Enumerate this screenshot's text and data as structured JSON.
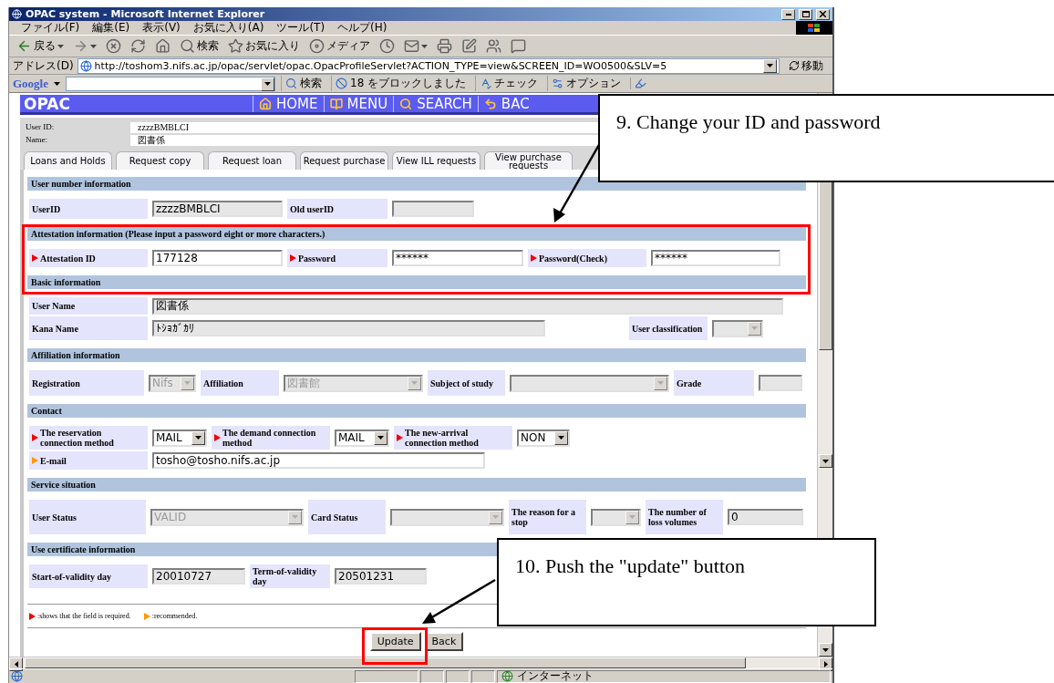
{
  "window": {
    "title": "OPAC system - Microsoft Internet Explorer"
  },
  "menu": [
    "ファイル(F)",
    "編集(E)",
    "表示(V)",
    "お気に入り(A)",
    "ツール(T)",
    "ヘルプ(H)"
  ],
  "toolbar": [
    {
      "kind": "back",
      "label": "戻る"
    },
    {
      "kind": "forward"
    },
    {
      "kind": "stop"
    },
    {
      "kind": "refresh"
    },
    {
      "kind": "home"
    },
    {
      "kind": "search",
      "label": "検索"
    },
    {
      "kind": "favorites",
      "label": "お気に入り"
    },
    {
      "kind": "media",
      "label": "メディア"
    },
    {
      "kind": "history"
    },
    {
      "kind": "mail"
    },
    {
      "kind": "print"
    },
    {
      "kind": "edit"
    },
    {
      "kind": "discuss"
    },
    {
      "kind": "messenger"
    }
  ],
  "address": {
    "label": "アドレス(D)",
    "url": "http://toshom3.nifs.ac.jp/opac/servlet/opac.OpacProfileServlet?ACTION_TYPE=view&SCREEN_ID=WO0500&SLV=5",
    "go": "移動"
  },
  "google_bar": {
    "logo": "Google",
    "items": [
      {
        "kind": "search",
        "label": "検索"
      },
      {
        "kind": "blocked",
        "label": "18 をブロックしました"
      },
      {
        "kind": "check",
        "label": "チェック"
      },
      {
        "kind": "options",
        "label": "オプション"
      },
      {
        "kind": "highlight"
      }
    ]
  },
  "opac": {
    "logo": "OPAC",
    "nav": [
      {
        "kind": "home",
        "label": "HOME"
      },
      {
        "kind": "menu",
        "label": "MENU"
      },
      {
        "kind": "search",
        "label": "SEARCH"
      },
      {
        "kind": "back",
        "label": "BAC"
      }
    ]
  },
  "user": {
    "id_label": "User ID:",
    "id": "zzzzBMBLCI",
    "name_label": "Name:",
    "name": "図書係"
  },
  "tabs": [
    "Loans and Holds",
    "Request copy",
    "Request loan",
    "Request purchase",
    "View ILL requests",
    "View purchase requests"
  ],
  "sections": [
    {
      "title": "User number information",
      "rows": [
        [
          {
            "label": "UserID",
            "kind": "text",
            "value": "zzzzBMBLCI",
            "disabled": true
          },
          {
            "label": "Old userID",
            "kind": "text",
            "disabled": true
          }
        ]
      ]
    },
    {
      "title": "Attestation information (Please input a password eight or more characters.)",
      "rows": [
        [
          {
            "label": "Attestation ID",
            "color": "#f00000",
            "kind": "text",
            "value": "177128",
            "disabled": false
          },
          {
            "label": "Password",
            "color": "#f00000",
            "kind": "text",
            "value": "******",
            "disabled": false
          },
          {
            "label": "Password(Check)",
            "color": "#f00000",
            "kind": "text",
            "value": "******",
            "disabled": false
          }
        ]
      ]
    },
    {
      "title": "Basic information",
      "rows": [
        [
          {
            "label": "User Name",
            "kind": "text",
            "value": "図書係",
            "disabled": true
          }
        ],
        [
          {
            "label": "Kana Name",
            "kind": "text",
            "value": "ﾄｼｮｶﾞｶﾘ",
            "disabled": true
          },
          {
            "label": "User classification",
            "kind": "select",
            "disabled": true
          }
        ]
      ]
    },
    {
      "title": "Affiliation information",
      "rows": [
        [
          {
            "label": "Registration",
            "kind": "select",
            "value": "Nifs",
            "disabled": true
          },
          {
            "label": "Affiliation",
            "kind": "select",
            "value": "図書館",
            "disabled": true
          },
          {
            "label": "Subject of study",
            "kind": "select",
            "disabled": true
          },
          {
            "label": "Grade",
            "kind": "text",
            "disabled": true
          }
        ]
      ]
    },
    {
      "title": "Contact",
      "rows": [
        [
          {
            "label": "The reservation connection method",
            "color": "#f00000",
            "kind": "select",
            "value": "MAIL",
            "disabled": false
          },
          {
            "label": "The demand connection method",
            "color": "#f00000",
            "kind": "select",
            "value": "MAIL",
            "disabled": false
          },
          {
            "label": "The new-arrival connection method",
            "color": "#f00000",
            "kind": "select",
            "value": "NON",
            "disabled": false
          }
        ],
        [
          {
            "label": "E-mail",
            "color": "#ff9900",
            "kind": "text",
            "value": "tosho@tosho.nifs.ac.jp",
            "disabled": false
          }
        ]
      ]
    },
    {
      "title": "Service situation",
      "rows": [
        [
          {
            "label": "User Status",
            "kind": "select",
            "value": "VALID",
            "disabled": true
          },
          {
            "label": "Card Status",
            "kind": "select",
            "disabled": true
          },
          {
            "label": "The reason for a stop",
            "kind": "select",
            "disabled": true
          },
          {
            "label": "The number of loss volumes",
            "kind": "text",
            "value": "0",
            "disabled": true
          }
        ]
      ]
    },
    {
      "title": "Use certificate information",
      "rows": [
        [
          {
            "label": "Start-of-validity day",
            "kind": "text",
            "value": "20010727",
            "disabled": true
          },
          {
            "label": "Term-of-validity day",
            "kind": "text",
            "value": "20501231",
            "disabled": true
          }
        ]
      ]
    }
  ],
  "legend": [
    {
      "color": "#f00000",
      "text": ":shows that the field is required."
    },
    {
      "color": "#ff9900",
      "text": ":recommended."
    }
  ],
  "buttons": [
    "Update",
    "Back"
  ],
  "status_bar": {
    "zone": "インターネット"
  },
  "callouts": [
    "9. Change your ID and password",
    "10. Push the \"update\" button"
  ]
}
